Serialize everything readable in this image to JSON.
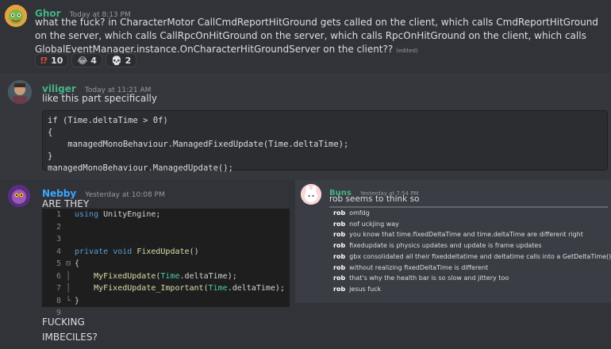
{
  "colors": {
    "ghor": "#43b581",
    "viliger": "#43b581",
    "nebby": "#3ba7ff",
    "buns": "#43b581"
  },
  "messages": [
    {
      "username": "Ghor",
      "timestamp": "Today at 8:13 PM",
      "text": "what the fuck? in CharacterMotor CallCmdReportHitGround gets called on the client, which calls CmdReportHitGround on the server, which calls CallRpcOnHitGround on the server, which calls RpcOnHitGround on the client, which calls GlobalEventManager.instance.OnCharacterHitGroundServer on the client??",
      "edited": "(edited)",
      "reactions": [
        {
          "emoji": "⁉",
          "count": "10"
        },
        {
          "emoji": "😂",
          "count": "4"
        },
        {
          "emoji": "💀",
          "count": "2"
        }
      ]
    },
    {
      "username": "viliger",
      "timestamp": "Today at 11:21 AM",
      "text": "like this part specifically",
      "code": "if (Time.deltaTime > 0f)\n{\n    managedMonoBehaviour.ManagedFixedUpdate(Time.deltaTime);\n}\nmanagedMonoBehaviour.ManagedUpdate();"
    },
    {
      "username": "Nebby",
      "timestamp": "Yesterday at 10:08 PM",
      "text1": "ARE THEY",
      "code_lines": [
        "1",
        "2",
        "3",
        "4",
        "5",
        "6",
        "7",
        "8",
        "9"
      ],
      "code_tokens": {
        "using": "using",
        "unity": "UnityEngine;",
        "private": "private",
        "void": "void",
        "fixedupdate": "FixedUpdate",
        "parens": "()",
        "brace_open": "{",
        "call1": "MyFixedUpdate",
        "call2": "MyFixedUpdate_Important",
        "time": "Time",
        "dt": ".deltaTime);",
        "open": "(",
        "brace_close": "}"
      },
      "text2a": "FUCKING",
      "text2b": "IMBECILES?"
    },
    {
      "username": "Buns",
      "timestamp": "Yesterday at 7:54 PM",
      "text": "rob seems to think so",
      "chat": [
        {
          "name": "rob",
          "msg": "omfdg"
        },
        {
          "name": "rob",
          "msg": "nof uckjing way"
        },
        {
          "name": "rob",
          "msg": "you know that time.fixedDeltaTime and time.deltaTime are different right"
        },
        {
          "name": "rob",
          "msg": "fixedupdate is physics updates and update is frame updates"
        },
        {
          "name": "rob",
          "msg": "gbx consolidated all their fixeddeltatime and deltatime calls into a GetDeltaTime() method"
        },
        {
          "name": "rob",
          "msg": "without realizing fixedDeltaTime is different"
        },
        {
          "name": "rob",
          "msg": "that's why the health bar is so slow and jittery too"
        },
        {
          "name": "rob",
          "msg": "jesus fuck"
        }
      ]
    }
  ]
}
